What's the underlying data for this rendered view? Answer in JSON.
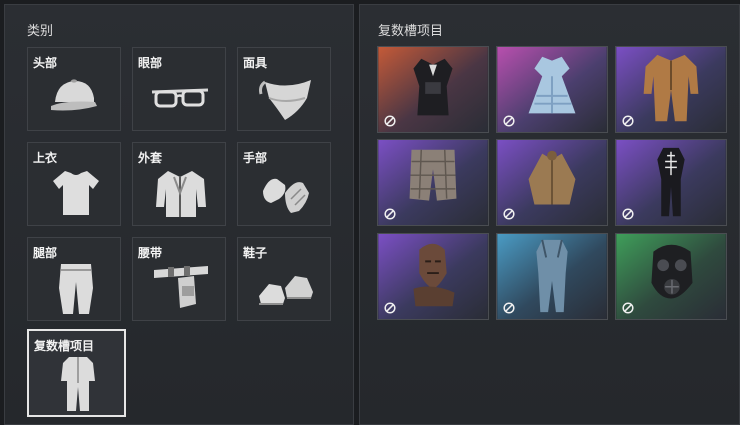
{
  "categories_panel": {
    "title": "类别",
    "items": [
      {
        "label": "头部",
        "icon": "cap-icon"
      },
      {
        "label": "眼部",
        "icon": "glasses-icon"
      },
      {
        "label": "面具",
        "icon": "bandana-mask-icon"
      },
      {
        "label": "上衣",
        "icon": "tshirt-icon"
      },
      {
        "label": "外套",
        "icon": "jacket-icon"
      },
      {
        "label": "手部",
        "icon": "gloves-icon"
      },
      {
        "label": "腿部",
        "icon": "pants-icon"
      },
      {
        "label": "腰带",
        "icon": "belt-holster-icon"
      },
      {
        "label": "鞋子",
        "icon": "sneakers-icon"
      },
      {
        "label": "复数槽项目",
        "icon": "jumpsuit-icon",
        "selected": true
      }
    ]
  },
  "multislot_panel": {
    "title": "复数槽项目",
    "items": [
      {
        "name": "black-corset-dress-outfit",
        "rarity_color": "#c3563e",
        "locked_icon": "ban-icon"
      },
      {
        "name": "blue-plaid-dress-outfit",
        "rarity_color": "#9c4bb0",
        "locked_icon": "ban-icon"
      },
      {
        "name": "tan-safari-suit-outfit",
        "rarity_color": "#7a4fc0",
        "locked_icon": "ban-icon"
      },
      {
        "name": "plaid-shorts-outfit",
        "rarity_color": "#7a4fc0",
        "locked_icon": "ban-icon"
      },
      {
        "name": "ragged-poncho-outfit",
        "rarity_color": "#7a4fc0",
        "locked_icon": "ban-icon"
      },
      {
        "name": "skeleton-bodysuit-outfit",
        "rarity_color": "#7a4fc0",
        "locked_icon": "ban-icon"
      },
      {
        "name": "leather-gimp-mask-outfit",
        "rarity_color": "#7a4fc0",
        "locked_icon": "ban-icon"
      },
      {
        "name": "denim-overalls-outfit",
        "rarity_color": "#4a8fb8",
        "locked_icon": "ban-icon"
      },
      {
        "name": "gas-mask-outfit",
        "rarity_color": "#3f8f5a",
        "locked_icon": "ban-icon"
      }
    ]
  }
}
